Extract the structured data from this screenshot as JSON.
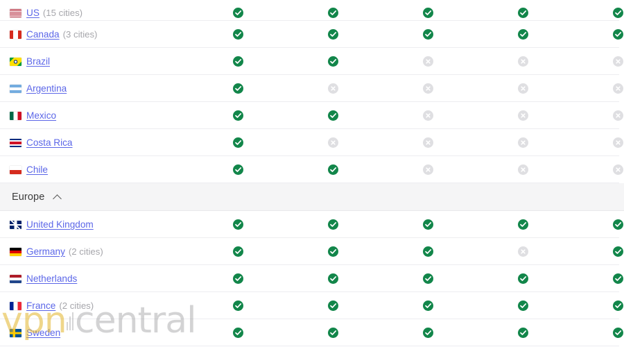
{
  "table": {
    "columns": [
      "col-1",
      "col-2",
      "col-3",
      "col-4",
      "col-5"
    ],
    "icons": {
      "yes": "check-circle-icon",
      "no": "x-circle-icon",
      "collapse": "chevron-up-icon"
    },
    "colors": {
      "yes": "#12864a",
      "no": "#dfdfe2",
      "link": "#5b66e8",
      "section_bg": "#f5f5f6",
      "row_divider": "#ededf0"
    },
    "rows": [
      {
        "type": "country",
        "flag": "🇺🇸",
        "flag_name": "flag-us",
        "name": "US",
        "cities": "(15 cities)",
        "status": [
          "yes",
          "yes",
          "yes",
          "yes",
          "yes"
        ]
      },
      {
        "type": "country",
        "flag": "🇨🇦",
        "flag_name": "flag-canada",
        "name": "Canada",
        "cities": "(3 cities)",
        "status": [
          "yes",
          "yes",
          "yes",
          "yes",
          "yes"
        ]
      },
      {
        "type": "country",
        "flag": "🇧🇷",
        "flag_name": "flag-brazil",
        "name": "Brazil",
        "cities": "",
        "status": [
          "yes",
          "yes",
          "no",
          "no",
          "no"
        ]
      },
      {
        "type": "country",
        "flag": "🇦🇷",
        "flag_name": "flag-argentina",
        "name": "Argentina",
        "cities": "",
        "status": [
          "yes",
          "no",
          "no",
          "no",
          "no"
        ]
      },
      {
        "type": "country",
        "flag": "🇲🇽",
        "flag_name": "flag-mexico",
        "name": "Mexico",
        "cities": "",
        "status": [
          "yes",
          "yes",
          "no",
          "no",
          "no"
        ]
      },
      {
        "type": "country",
        "flag": "🇨🇷",
        "flag_name": "flag-costa-rica",
        "name": "Costa Rica",
        "cities": "",
        "status": [
          "yes",
          "no",
          "no",
          "no",
          "no"
        ]
      },
      {
        "type": "country",
        "flag": "🇨🇱",
        "flag_name": "flag-chile",
        "name": "Chile",
        "cities": "",
        "status": [
          "yes",
          "yes",
          "no",
          "no",
          "no"
        ]
      },
      {
        "type": "section",
        "label": "Europe",
        "collapse_icon": "chevron-up-icon"
      },
      {
        "type": "country",
        "flag": "🇬🇧",
        "flag_name": "flag-united-kingdom",
        "name": "United Kingdom",
        "cities": "",
        "status": [
          "yes",
          "yes",
          "yes",
          "yes",
          "yes"
        ]
      },
      {
        "type": "country",
        "flag": "🇩🇪",
        "flag_name": "flag-germany",
        "name": "Germany",
        "cities": "(2 cities)",
        "status": [
          "yes",
          "yes",
          "yes",
          "no",
          "yes"
        ]
      },
      {
        "type": "country",
        "flag": "🇳🇱",
        "flag_name": "flag-netherlands",
        "name": "Netherlands",
        "cities": "",
        "status": [
          "yes",
          "yes",
          "yes",
          "yes",
          "yes"
        ]
      },
      {
        "type": "country",
        "flag": "🇫🇷",
        "flag_name": "flag-france",
        "name": "France",
        "cities": "(2 cities)",
        "status": [
          "yes",
          "yes",
          "yes",
          "yes",
          "yes"
        ]
      },
      {
        "type": "country",
        "flag": "🇸🇪",
        "flag_name": "flag-sweden",
        "name": "Sweden",
        "cities": "",
        "status": [
          "yes",
          "yes",
          "yes",
          "yes",
          "yes"
        ]
      }
    ]
  },
  "watermark": {
    "text_primary": "vpn",
    "text_secondary": "central",
    "icon": "signal-bars-icon"
  }
}
